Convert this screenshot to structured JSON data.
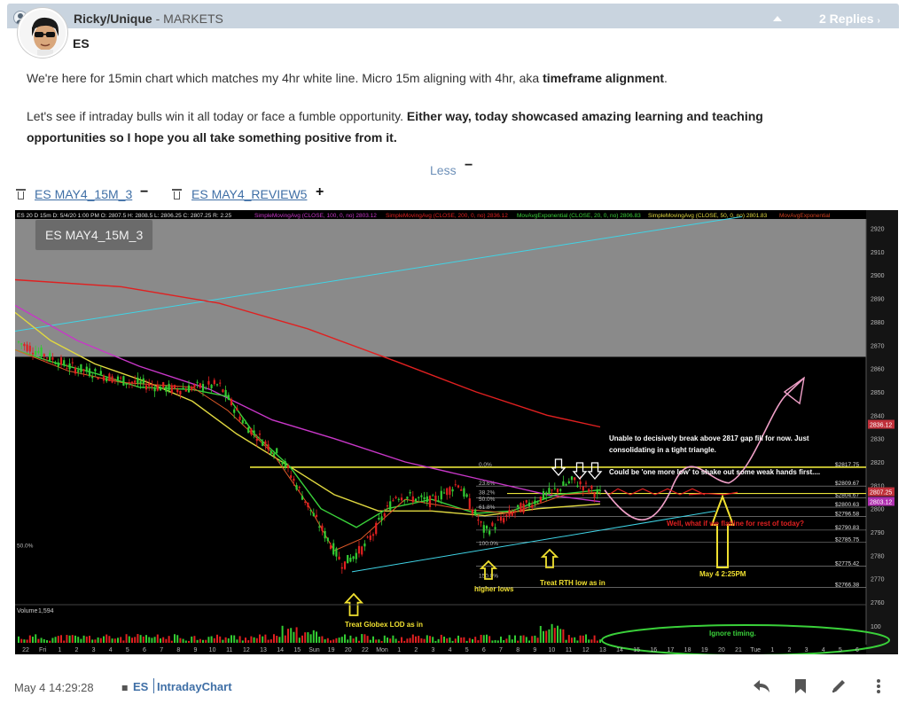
{
  "header": {
    "author": "Ricky/Unique",
    "separator": " - ",
    "room": "MARKETS",
    "replies_label": "2 Replies",
    "replies_chevron": "›"
  },
  "post": {
    "title": "ES",
    "p1_text": "We're here for 15min chart which matches my 4hr white line. Micro 15m aligning with 4hr, aka ",
    "p1_bold": "timeframe alignment",
    "p1_end": ".",
    "p2_text": "Let's see if intraday bulls win it all today or face a fumble opportunity. ",
    "p2_bold": "Either way, today showcased amazing learning and teaching opportunities so I hope you all take something positive from it.",
    "less_label": "Less",
    "less_sign": "−"
  },
  "attachments": [
    {
      "name": "ES MAY4_15M_3",
      "sign": "−"
    },
    {
      "name": "ES MAY4_REVIEW5",
      "sign": "+"
    }
  ],
  "chart_badge": "ES MAY4_15M_3",
  "chart_data": {
    "type": "line",
    "title": "",
    "header_text": "ES 20 D 15m  D: 5/4/20 1:00 PM  O: 2807.5  H: 2808.5  L: 2806.25  C: 2807.25  R: 2.25",
    "indicators": [
      {
        "name": "SimpleMovingAvg (CLOSE, 100, 0, no)",
        "value": "2803.12",
        "color": "#c837c8"
      },
      {
        "name": "SimpleMovingAvg (CLOSE, 200, 0, no)",
        "value": "2836.12",
        "color": "#e02020"
      },
      {
        "name": "MovAvgExponential (CLOSE, 20, 0, no)",
        "value": "2806.83",
        "color": "#3ad13a"
      },
      {
        "name": "SimpleMovingAvg (CLOSE, 50, 0, no)",
        "value": "2801.83",
        "color": "#e0d840"
      },
      {
        "name": "MovAvgExponential",
        "value": "",
        "color": "#d04020"
      }
    ],
    "y_ticks": [
      "2920",
      "2910",
      "2900",
      "2890",
      "2880",
      "2870",
      "2860",
      "2850",
      "2840",
      "2830",
      "2820",
      "2810",
      "2800",
      "2790",
      "2780",
      "2770",
      "2760"
    ],
    "ylim": [
      2757,
      2924
    ],
    "price_tags": [
      {
        "label": "2836.12",
        "value": 2836.12,
        "color": "#c0303a"
      },
      {
        "label": "2807.25",
        "value": 2807.25,
        "color": "#c0303a"
      },
      {
        "label": "2803.12",
        "value": 2803.12,
        "color": "#b030b0"
      }
    ],
    "level_labels": [
      {
        "label": "$2817.75",
        "value": 2817.75
      },
      {
        "label": "$2809.67",
        "value": 2809.67
      },
      {
        "label": "$2804.67",
        "value": 2804.67
      },
      {
        "label": "$2800.63",
        "value": 2800.63
      },
      {
        "label": "$2796.58",
        "value": 2796.58
      },
      {
        "label": "$2790.83",
        "value": 2790.83
      },
      {
        "label": "$2785.75",
        "value": 2785.75
      },
      {
        "label": "$2775.42",
        "value": 2775.42
      },
      {
        "label": "$2766.38",
        "value": 2766.38
      }
    ],
    "fib_labels": [
      "0.0%",
      "23.6%",
      "38.2%",
      "50.0%",
      "61.8%",
      "100.0%",
      "150.0%"
    ],
    "x_ticks": [
      "22",
      "Fri",
      "1",
      "2",
      "3",
      "4",
      "5",
      "6",
      "7",
      "8",
      "9",
      "10",
      "11",
      "12",
      "13",
      "14",
      "15",
      "Sun",
      "19",
      "20",
      "22",
      "Mon",
      "1",
      "2",
      "3",
      "4",
      "5",
      "6",
      "7",
      "8",
      "9",
      "10",
      "11",
      "12",
      "13",
      "14",
      "15",
      "16",
      "17",
      "18",
      "19",
      "20",
      "21",
      "Tue",
      "1",
      "2",
      "3",
      "4",
      "5",
      "6"
    ],
    "volume_label": "Volume",
    "volume_value": "1,594",
    "volume_tick": "100",
    "left_pct": "50.0%",
    "annotations": {
      "text1": "Unable to decisively break above 2817 gap fill for now. Just",
      "text2": "consolidating in a tight triangle.",
      "text3": "Could be 'one more low' to shake out some weak hands first....",
      "text4": "Well, what if we flatline for rest of today?",
      "lod": "Treat Globex LOD as in",
      "higher_lows": "higher lows",
      "rth": "Treat RTH low as in",
      "may4": "May 4   2:25PM",
      "ignore": "Ignore timing."
    }
  },
  "footer": {
    "timestamp": "May 4 14:29:28",
    "tag1": "ES",
    "tag2": "IntradayChart"
  },
  "icons": [
    "user-icon",
    "collapse-icon",
    "chevron-right-icon",
    "trash-icon",
    "reply-icon",
    "bookmark-icon",
    "edit-icon",
    "more-icon",
    "tag-pin-icon"
  ]
}
